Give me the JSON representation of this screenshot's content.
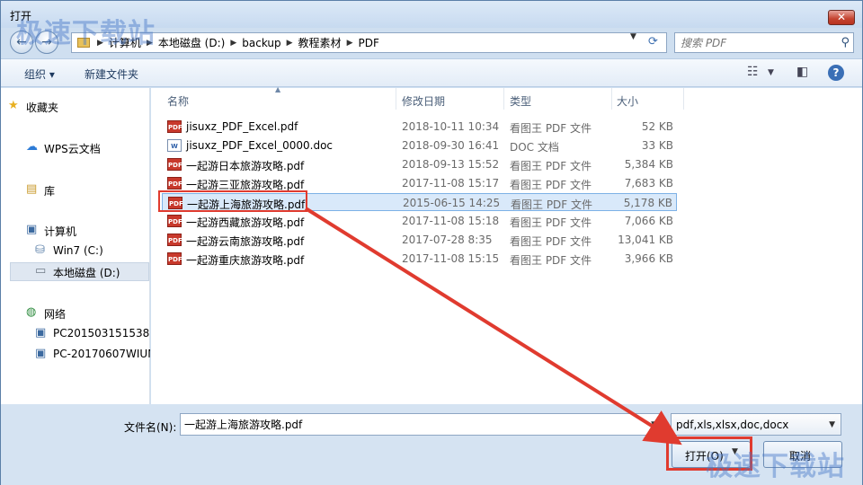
{
  "window": {
    "title": "打开",
    "close_glyph": "✕"
  },
  "watermark": "极速下载站",
  "address": {
    "crumbs": [
      "计算机",
      "本地磁盘 (D:)",
      "backup",
      "教程素材",
      "PDF"
    ],
    "search_placeholder": "搜索 PDF"
  },
  "toolbar": {
    "organize_label": "组织 ▾",
    "new_folder_label": "新建文件夹"
  },
  "sidebar": {
    "favorites": "收藏夹",
    "wps_docs": "WPS云文档",
    "library": "库",
    "computer": "计算机",
    "win7_drive": "Win7 (C:)",
    "local_disk": "本地磁盘 (D:)",
    "network": "网络",
    "pc1": "PC201503151538",
    "pc2": "PC-20170607WIUN"
  },
  "columns": {
    "name": "名称",
    "date": "修改日期",
    "type": "类型",
    "size": "大小"
  },
  "files": [
    {
      "name": "jisuxz_PDF_Excel.pdf",
      "date": "2018-10-11 10:34",
      "type": "看图王 PDF 文件",
      "size": "52 KB",
      "icon": "pdf"
    },
    {
      "name": "jisuxz_PDF_Excel_0000.doc",
      "date": "2018-09-30 16:41",
      "type": "DOC 文档",
      "size": "33 KB",
      "icon": "doc"
    },
    {
      "name": "一起游日本旅游攻略.pdf",
      "date": "2018-09-13 15:52",
      "type": "看图王 PDF 文件",
      "size": "5,384 KB",
      "icon": "pdf"
    },
    {
      "name": "一起游三亚旅游攻略.pdf",
      "date": "2017-11-08 15:17",
      "type": "看图王 PDF 文件",
      "size": "7,683 KB",
      "icon": "pdf"
    },
    {
      "name": "一起游上海旅游攻略.pdf",
      "date": "2015-06-15 14:25",
      "type": "看图王 PDF 文件",
      "size": "5,178 KB",
      "icon": "pdf",
      "selected": true
    },
    {
      "name": "一起游西藏旅游攻略.pdf",
      "date": "2017-11-08 15:18",
      "type": "看图王 PDF 文件",
      "size": "7,066 KB",
      "icon": "pdf"
    },
    {
      "name": "一起游云南旅游攻略.pdf",
      "date": "2017-07-28 8:35",
      "type": "看图王 PDF 文件",
      "size": "13,041 KB",
      "icon": "pdf"
    },
    {
      "name": "一起游重庆旅游攻略.pdf",
      "date": "2017-11-08 15:15",
      "type": "看图王 PDF 文件",
      "size": "3,966 KB",
      "icon": "pdf"
    }
  ],
  "footer": {
    "filename_label": "文件名(N):",
    "filename_value": "一起游上海旅游攻略.pdf",
    "filter_value": "pdf,xls,xlsx,doc,docx",
    "open_label": "打开(O)",
    "cancel_label": "取消"
  },
  "colors": {
    "highlight_red": "#e03b2f",
    "selection_blue": "#d9e9fa",
    "pdf_red": "#c8392c"
  }
}
